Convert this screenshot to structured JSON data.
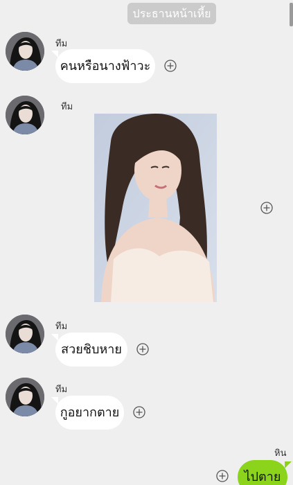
{
  "header": {
    "group_name": "ประธานหน้าเหี้ย"
  },
  "messages": [
    {
      "sender": "ทีม",
      "text": "คนหรือนางฟ้าวะ",
      "type": "text",
      "direction": "incoming"
    },
    {
      "sender": "ทีม",
      "type": "image",
      "image_alt": "photo",
      "direction": "incoming"
    },
    {
      "sender": "ทีม",
      "text": "สวยชิบหาย",
      "type": "text",
      "direction": "incoming"
    },
    {
      "sender": "ทีม",
      "text": "กูอยากตาย",
      "type": "text",
      "direction": "incoming"
    },
    {
      "sender": "หิน",
      "text": "ไปตาย",
      "type": "text",
      "direction": "outgoing"
    }
  ],
  "icons": {
    "add_reaction": "plus-circle-icon",
    "avatar": "avatar-icon"
  },
  "colors": {
    "background": "#efefef",
    "incoming_bubble": "#ffffff",
    "outgoing_bubble": "#8bd41b",
    "header_chip": "#cbcbcb"
  }
}
